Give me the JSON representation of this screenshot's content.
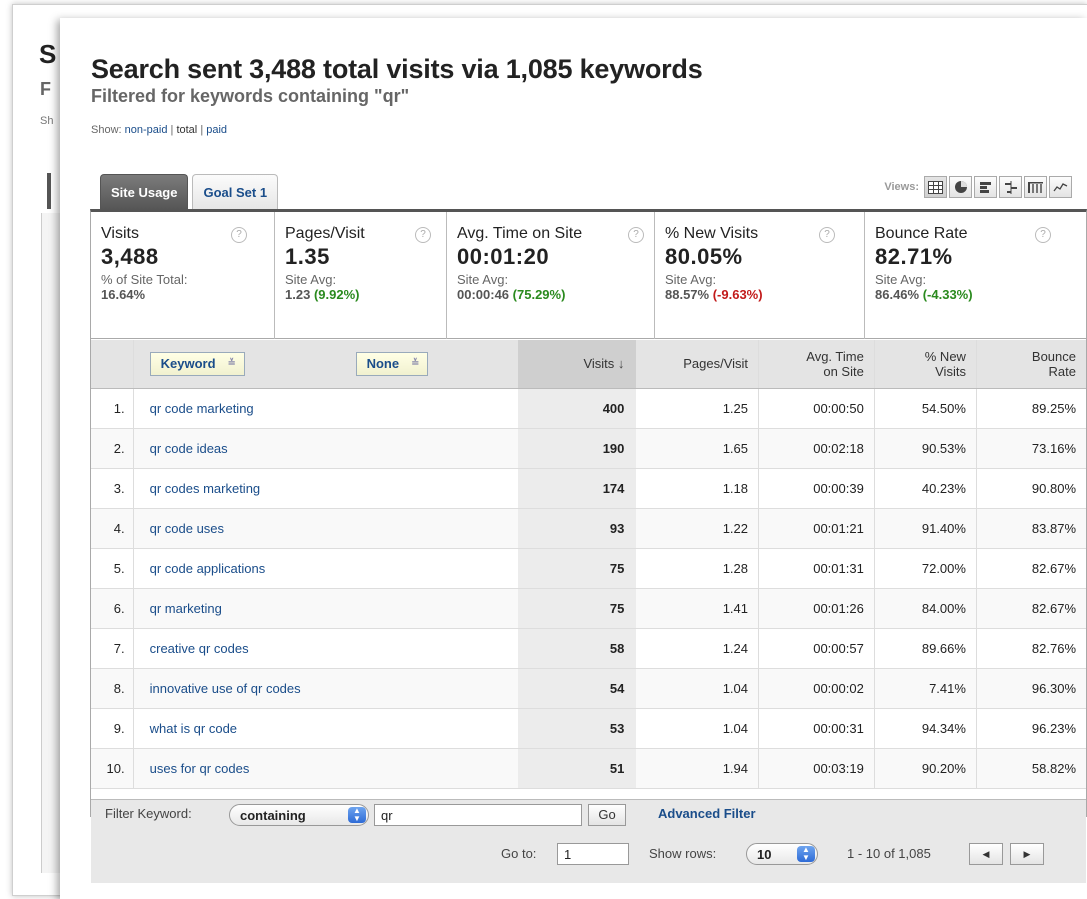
{
  "background_window": {
    "title_initial": "S",
    "subtitle_initial": "F",
    "show_initial": "Sh"
  },
  "header": {
    "title": "Search sent 3,488 total visits via 1,085 keywords",
    "subtitle": "Filtered for keywords containing \"qr\"",
    "show_label": "Show:",
    "show_options": [
      "non-paid",
      "total",
      "paid"
    ],
    "show_selected": "total",
    "separator": "|"
  },
  "tabs": [
    {
      "label": "Site Usage",
      "active": true
    },
    {
      "label": "Goal Set 1",
      "active": false
    }
  ],
  "views": {
    "label": "Views:",
    "buttons": [
      "table-icon",
      "pie-icon",
      "performance-icon",
      "comparison-icon",
      "pivot-icon",
      "sparkline-icon"
    ],
    "selected": "table-icon"
  },
  "scorecard": [
    {
      "name": "Visits",
      "value": "3,488",
      "sub": "% of Site Total:",
      "avg": "16.64%",
      "delta": "",
      "delta_sign": ""
    },
    {
      "name": "Pages/Visit",
      "value": "1.35",
      "sub": "Site Avg:",
      "avg": "1.23",
      "delta": "(9.92%)",
      "delta_sign": "pos"
    },
    {
      "name": "Avg. Time on Site",
      "value": "00:01:20",
      "sub": "Site Avg:",
      "avg": "00:00:46",
      "delta": "(75.29%)",
      "delta_sign": "pos"
    },
    {
      "name": "% New Visits",
      "value": "80.05%",
      "sub": "Site Avg:",
      "avg": "88.57%",
      "delta": "(-9.63%)",
      "delta_sign": "neg"
    },
    {
      "name": "Bounce Rate",
      "value": "82.71%",
      "sub": "Site Avg:",
      "avg": "86.46%",
      "delta": "(-4.33%)",
      "delta_sign": "pos"
    }
  ],
  "help_glyph": "?",
  "table": {
    "primary_dimension": "Keyword",
    "secondary_dimension": "None",
    "dropdown_glyph": "≚",
    "columns": {
      "visits": "Visits",
      "sort_arrow": "↓",
      "pages_visit": "Pages/Visit",
      "avg_time": [
        "Avg. Time",
        "on Site"
      ],
      "new_visits": [
        "% New",
        "Visits"
      ],
      "bounce_rate": [
        "Bounce",
        "Rate"
      ]
    },
    "rows": [
      {
        "idx": "1.",
        "keyword": "qr code marketing",
        "visits": "400",
        "pv": "1.25",
        "time": "00:00:50",
        "new": "54.50%",
        "br": "89.25%"
      },
      {
        "idx": "2.",
        "keyword": "qr code ideas",
        "visits": "190",
        "pv": "1.65",
        "time": "00:02:18",
        "new": "90.53%",
        "br": "73.16%"
      },
      {
        "idx": "3.",
        "keyword": "qr codes marketing",
        "visits": "174",
        "pv": "1.18",
        "time": "00:00:39",
        "new": "40.23%",
        "br": "90.80%"
      },
      {
        "idx": "4.",
        "keyword": "qr code uses",
        "visits": "93",
        "pv": "1.22",
        "time": "00:01:21",
        "new": "91.40%",
        "br": "83.87%"
      },
      {
        "idx": "5.",
        "keyword": "qr code applications",
        "visits": "75",
        "pv": "1.28",
        "time": "00:01:31",
        "new": "72.00%",
        "br": "82.67%"
      },
      {
        "idx": "6.",
        "keyword": "qr marketing",
        "visits": "75",
        "pv": "1.41",
        "time": "00:01:26",
        "new": "84.00%",
        "br": "82.67%"
      },
      {
        "idx": "7.",
        "keyword": "creative qr codes",
        "visits": "58",
        "pv": "1.24",
        "time": "00:00:57",
        "new": "89.66%",
        "br": "82.76%"
      },
      {
        "idx": "8.",
        "keyword": "innovative use of qr codes",
        "visits": "54",
        "pv": "1.04",
        "time": "00:00:02",
        "new": "7.41%",
        "br": "96.30%"
      },
      {
        "idx": "9.",
        "keyword": "what is qr code",
        "visits": "53",
        "pv": "1.04",
        "time": "00:00:31",
        "new": "94.34%",
        "br": "96.23%"
      },
      {
        "idx": "10.",
        "keyword": "uses for qr codes",
        "visits": "51",
        "pv": "1.94",
        "time": "00:03:19",
        "new": "90.20%",
        "br": "58.82%"
      }
    ]
  },
  "footer": {
    "filter_label": "Filter Keyword:",
    "filter_mode": "containing",
    "filter_value": "qr",
    "go_label": "Go",
    "advanced_label": "Advanced Filter",
    "goto_label": "Go to:",
    "goto_value": "1",
    "show_rows_label": "Show rows:",
    "show_rows_value": "10",
    "range_text": "1 - 10 of 1,085",
    "prev_glyph": "◀",
    "next_glyph": "▶",
    "spin_glyph_up": "▲",
    "spin_glyph_down": "▼"
  },
  "colors": {
    "link": "#1a4d8a",
    "positive": "#2a8a1e",
    "negative": "#c21a1a",
    "tab_active_bg": "#666666",
    "header_bg": "#e4e4e4"
  }
}
